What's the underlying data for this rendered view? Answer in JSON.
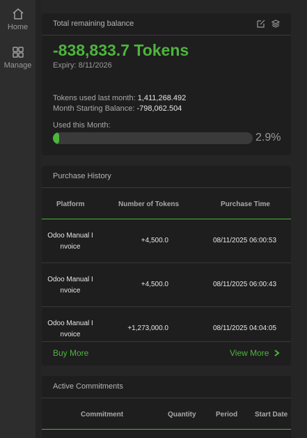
{
  "sidebar": {
    "items": [
      {
        "label": "Home",
        "icon": "home-icon"
      },
      {
        "label": "Manage",
        "icon": "grid-icon"
      }
    ]
  },
  "balance_card": {
    "title": "Total remaining balance",
    "balance": "-838,833.7 Tokens",
    "expiry": "Expiry: 8/11/2026",
    "used_last_month_label": "Tokens used last month:",
    "used_last_month_value": "1,411,268.492",
    "starting_balance_label": "Month Starting Balance:",
    "starting_balance_value": "-798,062.504",
    "used_this_month_label": "Used this Month:",
    "used_this_month_percent": "2.9%",
    "used_this_month_fraction": 0.029,
    "accent_color": "#4db53c"
  },
  "purchase_history": {
    "title": "Purchase History",
    "columns": [
      "Platform",
      "Number of Tokens",
      "Purchase Time"
    ],
    "rows": [
      {
        "platform": "Odoo Manual Invoice",
        "tokens": "+4,500.0",
        "time": "08/11/2025 06:00:53"
      },
      {
        "platform": "Odoo Manual Invoice",
        "tokens": "+4,500.0",
        "time": "08/11/2025 06:00:43"
      },
      {
        "platform": "Odoo Manual Invoice",
        "tokens": "+1,273,000.0",
        "time": "08/11/2025 04:04:05"
      }
    ],
    "buy_more": "Buy More",
    "view_more": "View More"
  },
  "commitments": {
    "title": "Active Commitments",
    "columns": [
      "Commitment",
      "Quantity",
      "Period",
      "Start Date"
    ]
  }
}
